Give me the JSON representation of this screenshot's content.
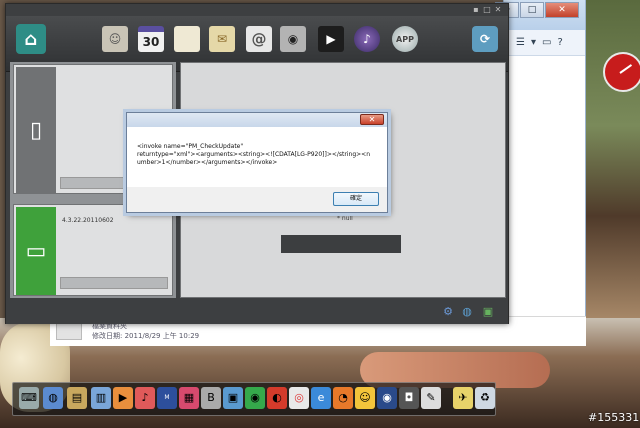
{
  "app": {
    "window_buttons": [
      "▪",
      "□",
      "✕"
    ],
    "devices": [
      {
        "version": ""
      },
      {
        "version": "4.3.22.20110602"
      }
    ],
    "right_panel_text": "* null"
  },
  "dialog": {
    "message_lines": [
      "<invoke name=\"PM_CheckUpdate\"",
      "returntype=\"xml\"><arguments><string><![CDATA[LG-P920]]></string><n",
      "umber>1</number></arguments></invoke>"
    ],
    "ok_label": "確定",
    "close_label": "✕"
  },
  "explorer": {
    "footer_line1": "檔案資料夾",
    "footer_line2": "修改日期: 2011/8/29 上午 10:29",
    "window_buttons": [
      "─",
      "□",
      "✕"
    ]
  },
  "watermark": "#155331"
}
